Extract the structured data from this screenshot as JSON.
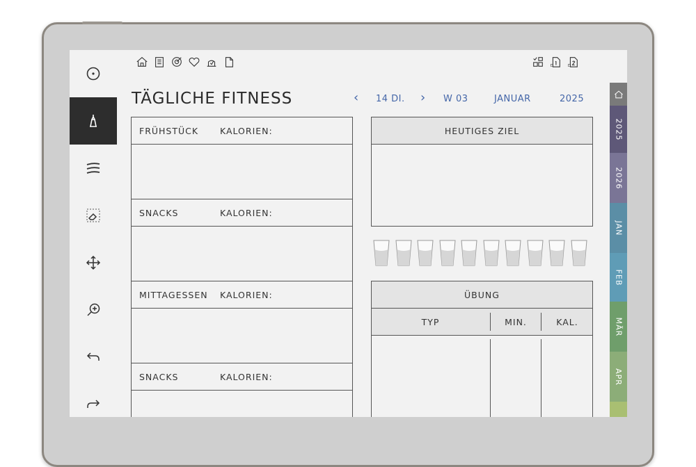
{
  "page": {
    "title": "TÄGLICHE FITNESS",
    "date": {
      "day": "14 DI.",
      "week": "W 03",
      "month": "JANUAR",
      "year": "2025"
    }
  },
  "toolbar_icons": [
    "circle-dot-icon",
    "pen-icon",
    "pen-thickness-icon",
    "eraser-icon",
    "move-icon",
    "zoom-icon",
    "undo-icon",
    "redo-icon"
  ],
  "top_icons_left": [
    "home-icon",
    "clipboard-icon",
    "target-icon",
    "heart-icon",
    "scale-icon",
    "page-icon"
  ],
  "top_icons_right": [
    "checklist-icon",
    "page-1-icon",
    "page-2-icon"
  ],
  "meals": [
    {
      "name": "FRÜHSTÜCK",
      "calories_label": "KALORIEN:"
    },
    {
      "name": "SNACKS",
      "calories_label": "KALORIEN:"
    },
    {
      "name": "MITTAGESSEN",
      "calories_label": "KALORIEN:"
    },
    {
      "name": "SNACKS",
      "calories_label": "KALORIEN:"
    }
  ],
  "goal": {
    "header": "HEUTIGES ZIEL"
  },
  "water": {
    "cup_count": 10
  },
  "exercise": {
    "header": "ÜBUNG",
    "columns": [
      "TYP",
      "MIN.",
      "KAL."
    ]
  },
  "tabs": [
    {
      "label": "home-icon",
      "color": "#7a7a7a"
    },
    {
      "label": "2025",
      "color": "#5e5878"
    },
    {
      "label": "2026",
      "color": "#7a7596"
    },
    {
      "label": "JAN",
      "color": "#5b8ea6"
    },
    {
      "label": "FEB",
      "color": "#5f9cb6"
    },
    {
      "label": "MÄR",
      "color": "#6f9e6b"
    },
    {
      "label": "APR",
      "color": "#8cad78"
    }
  ]
}
